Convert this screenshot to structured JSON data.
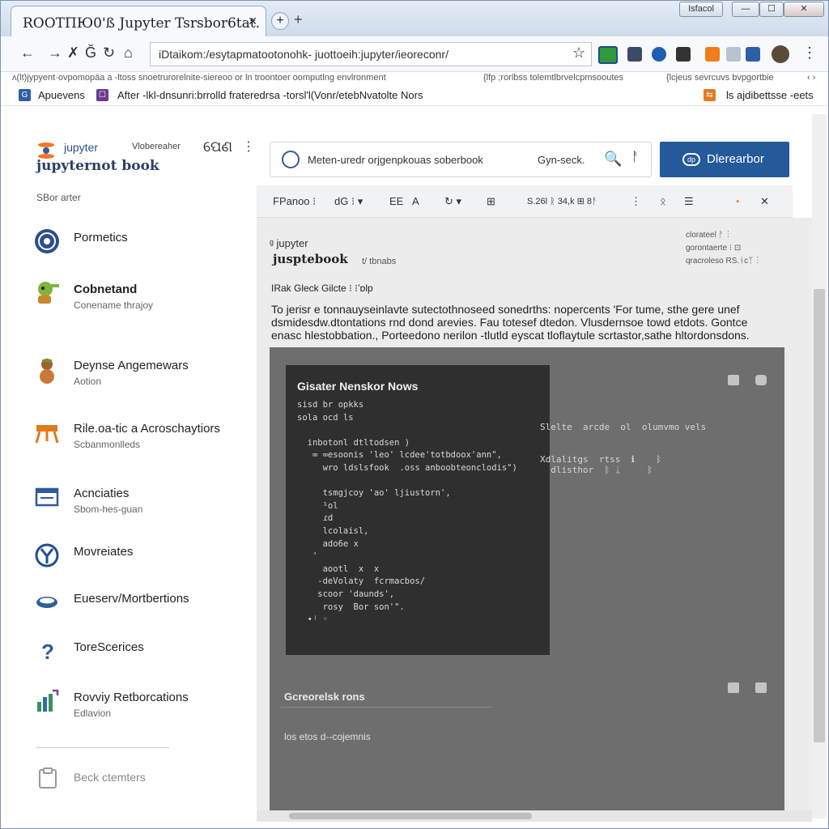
{
  "browser": {
    "tab_title": "ROOTПЮ0'ß Jupyter Tsrsbor6tat.",
    "tab_close": "✕",
    "new_tab": "+",
    "new_tab_plus": "+",
    "window_buttons": [
      "Isfacol",
      "—",
      "☐",
      "✕"
    ],
    "nav": {
      "back": "←",
      "forward": "→",
      "edit": "✗",
      "go": "Ğ",
      "refresh": "↻",
      "home": "⌂"
    },
    "url": "iDtaikom:/esytapmatootonohk- juottoeih:jupyter/ieoreconr/",
    "star": "☆",
    "menu": "⋮",
    "infobar": {
      "left": "ʌ(lt)jypyent·ovpomopäa a -ltoss snoetrurorelnite-siereoo or ln troontoer oomputlng envlronment",
      "mid": "{lfp ;rorlbss tolemtlbrvelcpmsooutes",
      "right": "{lcjeus sevrcuvs bvpgortbie",
      "arrows": "‹ ›"
    },
    "bookmarks": {
      "item1_icon": "G",
      "item1": "Apuevens",
      "item2_icon": "☐",
      "item3": "After -lkl-dnsunri:brrolld frateredrsa -torsl'l(Vonr/etebNvatolte Nors",
      "right_icon": "⇆",
      "right": "ls ajdibettsse -eets"
    }
  },
  "sidebar": {
    "logo_small": "jupyter",
    "logo_big": "jupyternot book",
    "logo_sub": "Vlobereaher",
    "logo_handle": "ପେଣ",
    "kebab": "⋮",
    "section_label": "SBor arter",
    "items": [
      {
        "title": "Pormetics",
        "sub": "",
        "icon": "disc-icon",
        "color": "#2c4f8a"
      },
      {
        "title": "Cobnetand",
        "sub": "Conename thrajoy",
        "icon": "creature-icon",
        "color": "#6c9a2d"
      },
      {
        "title": "Deynse Angemewars",
        "sub": "Aotion",
        "icon": "figure-icon",
        "color": "#9c5a2c"
      },
      {
        "title": "Rile.oa-tic a Acroschaytiors",
        "sub": "Scbanmonlleds",
        "icon": "easel-icon",
        "color": "#e07a1e"
      },
      {
        "title": "Acnciaties",
        "sub": "Sbom-hes-guan",
        "icon": "window-icon",
        "color": "#2c5aa0"
      },
      {
        "title": "Movreiates",
        "sub": "",
        "icon": "y-badge-icon",
        "color": "#1f4f8f"
      },
      {
        "title": "Eueserv/Mortbertions",
        "sub": "",
        "icon": "cloud-icon",
        "color": "#2f5f99"
      },
      {
        "title": "ToreScerices",
        "sub": "",
        "icon": "question-icon",
        "color": "#2e5a96"
      },
      {
        "title": "Rovviy Retborcations",
        "sub": "Edlavion",
        "icon": "chart-icon",
        "color": "#3b8f5f"
      }
    ],
    "back_label": "Beck ctemters"
  },
  "search": {
    "placeholder": "Meten-uredr orjgenpkouas soberbook",
    "hint": "Gyn-seck.",
    "mag": "🔍",
    "clear": "ᚨ"
  },
  "primary_button": {
    "label": "Dlerearbor",
    "icon": "dp"
  },
  "notebook": {
    "toolbar": [
      "FPanoo ⁝",
      "dG ⁝ ▾",
      "EE",
      "A",
      "↻ ▾",
      "⊞",
      "S.26l ᚱ 34,k ⊞ 8ᚨ",
      "⋮",
      "ᛟ",
      "☰",
      "•",
      "✕"
    ],
    "logo": "ᵍ jupyter",
    "title": "jusptebook",
    "title_sub": "t/ tbnabs",
    "meta": [
      "clorateel   ᚨ ⁝",
      "gorontaerte   ⁝ ⊡",
      "qracroleso RS.ᚾcᛉ  ⁝"
    ],
    "heading": "IRak Gleck Gilcte ⁝ ⁝ʼɒlp",
    "paragraph": "To jerisr e tonnauyseinlavte sutectothnoseed sonedrths: nopercents 'For tume, sthe gere unef dsmidesdw.dtontations rnd dond arevies. Fau totesef dtedon. Vlusdernsoe towd etdots. Gontce enasc hlestobbation., Porteedono nerilon -tlutld eyscat tloflaytule scrtastor,sathe hltordonsdons.",
    "cell": {
      "title": "Gisater Nenskor Nows",
      "code": "sisd br opkks\nsola ocd ls\n\n  inbotonl dtltodsen )\n   ∞ ∞esoonis 'leo' lcdee'totbdoox'ann\",\n     wro ldslsfook  .oss anboobteonclodis\")\n\n     tsmgjcoy 'ao' ljiustorn',\n     ¹ol\n     ɾd\n     lcolaisl,\n     ado6e x\n   '\n     aootl  x  x\n    -deVolaty  fcrmacbos/\n    scoor 'daunds',\n     rosy  Bor son'\".\n  ∙ʲ ◦",
      "side1": "Slelte  arcde  ol  olumvmo vels",
      "side2": "Xdlalitgs  rtss  ℹ    ᛒ\n  dlisthor  ᛒ ᛣ     ᛒ",
      "footer_title": "Gcreorelsk rons",
      "footer_text": "los etos d--cojemnis"
    }
  }
}
